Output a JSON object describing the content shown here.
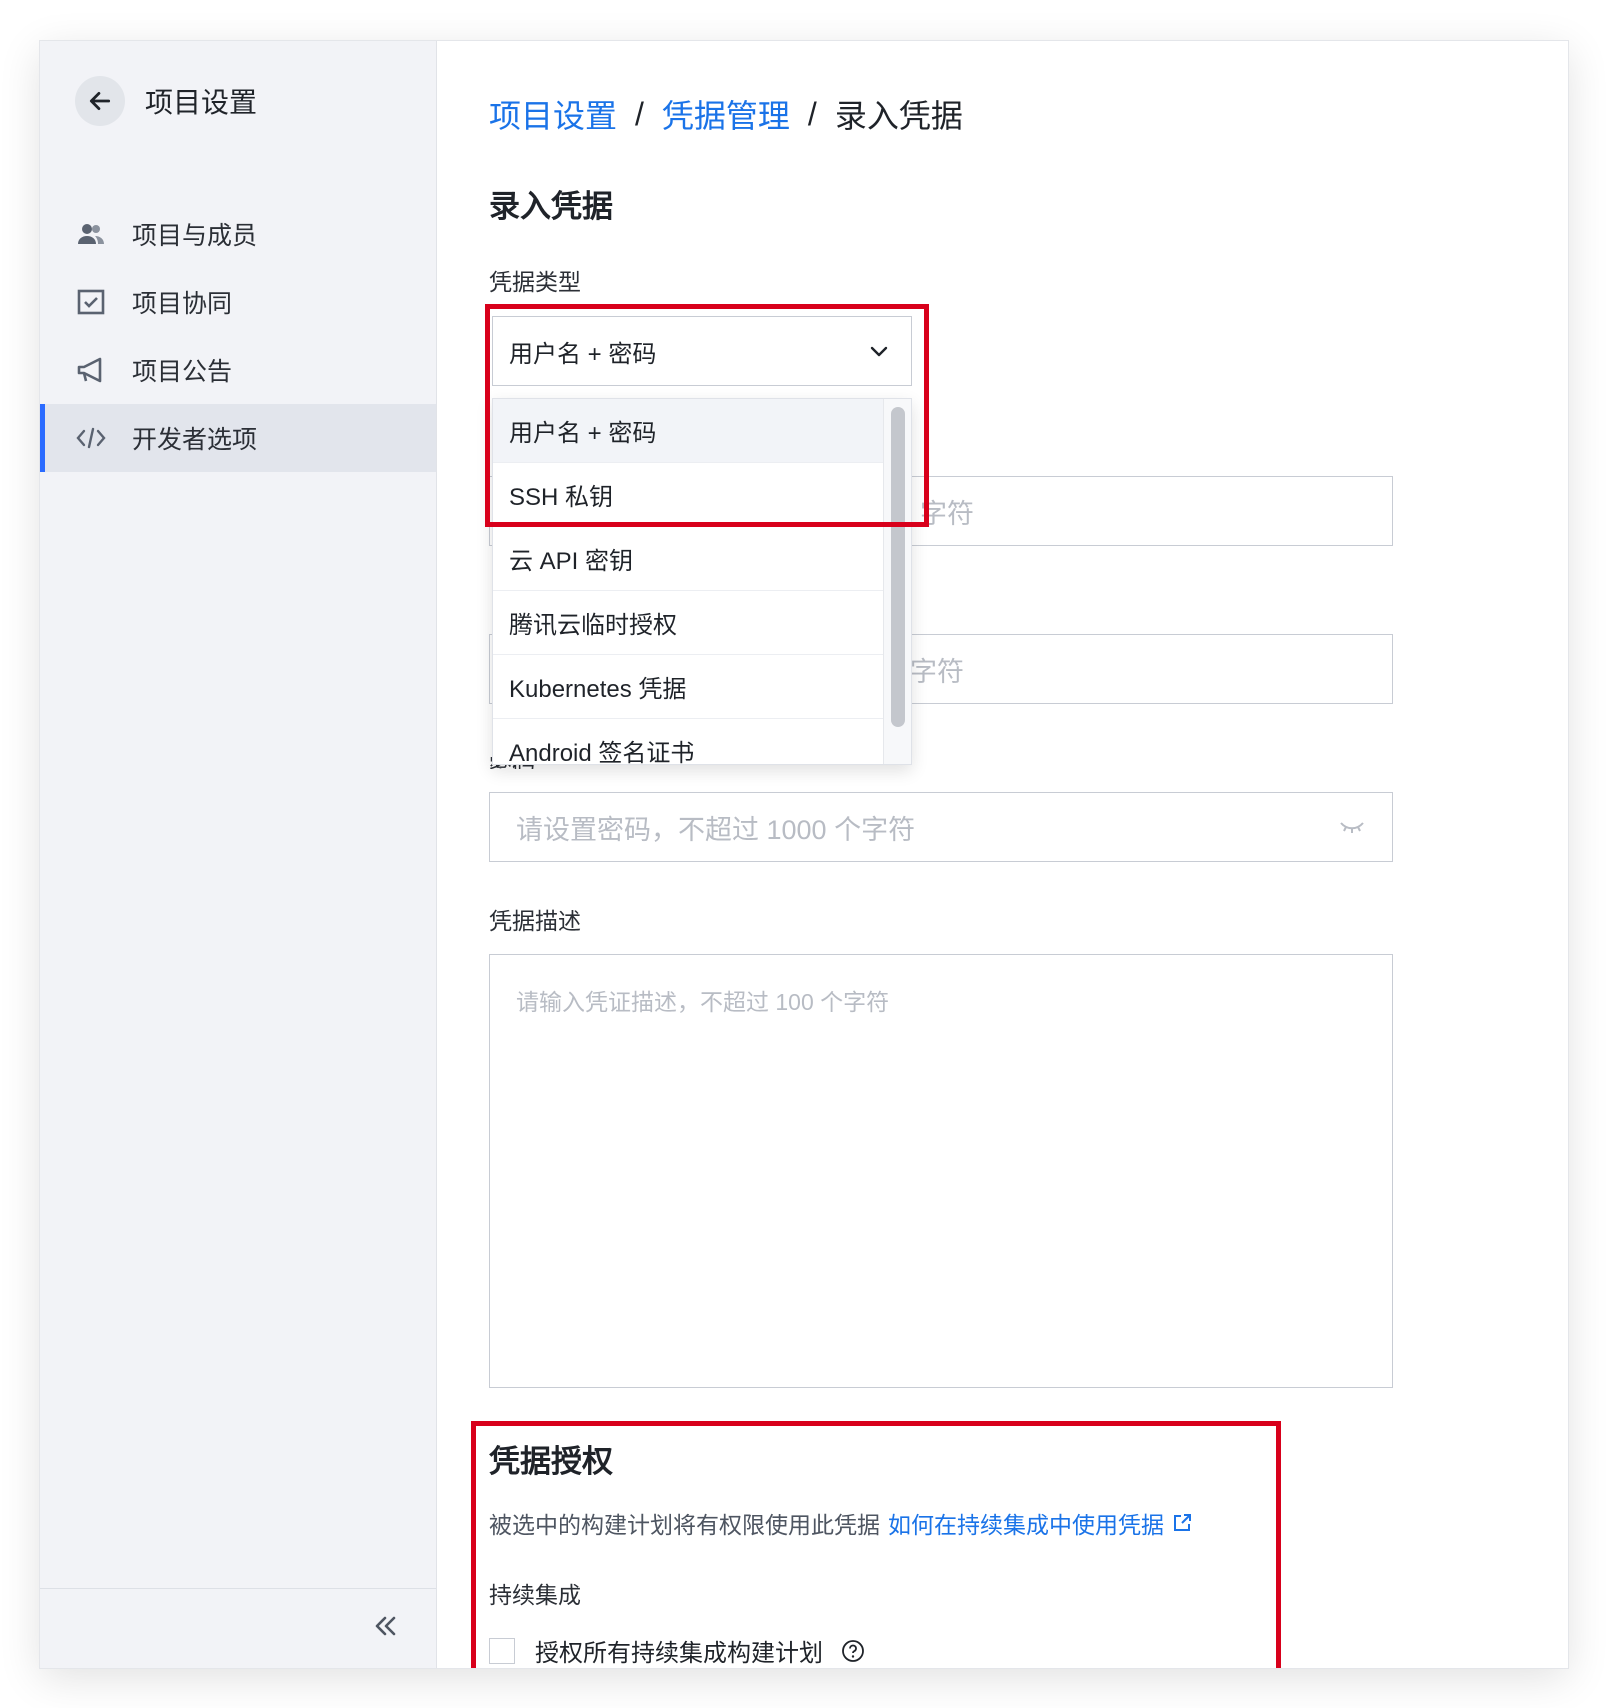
{
  "sidebar": {
    "title": "项目设置",
    "items": [
      {
        "label": "项目与成员",
        "icon": "users-icon"
      },
      {
        "label": "项目协同",
        "icon": "checkbox-square-icon"
      },
      {
        "label": "项目公告",
        "icon": "megaphone-icon"
      },
      {
        "label": "开发者选项",
        "icon": "code-icon",
        "active": true
      }
    ],
    "collapse_icon": "double-chevron-left-icon"
  },
  "breadcrumb": {
    "items": [
      "项目设置",
      "凭据管理"
    ],
    "separator": "/",
    "current": "录入凭据"
  },
  "page_title": "录入凭据",
  "form": {
    "type_label": "凭据类型",
    "type_value": "用户名 + 密码",
    "type_options": [
      "用户名 + 密码",
      "SSH 私钥",
      "云 API 密钥",
      "腾讯云临时授权",
      "Kubernetes 凭据",
      "Android 签名证书"
    ],
    "field1_placeholder_visible": "字符",
    "field2_placeholder_visible": "字符",
    "password_label_partial": "密码",
    "password_placeholder": "请设置密码，不超过 1000 个字符",
    "desc_label": "凭据描述",
    "desc_placeholder": "请输入凭证描述，不超过 100 个字符"
  },
  "authorization": {
    "title": "凭据授权",
    "desc": "被选中的构建计划将有权限使用此凭据",
    "link": "如何在持续集成中使用凭据",
    "ci_label": "持续集成",
    "checkbox_label": "授权所有持续集成构建计划"
  },
  "colors": {
    "accent": "#2b6bff",
    "link": "#1a73e8",
    "highlight": "#d8001b"
  }
}
